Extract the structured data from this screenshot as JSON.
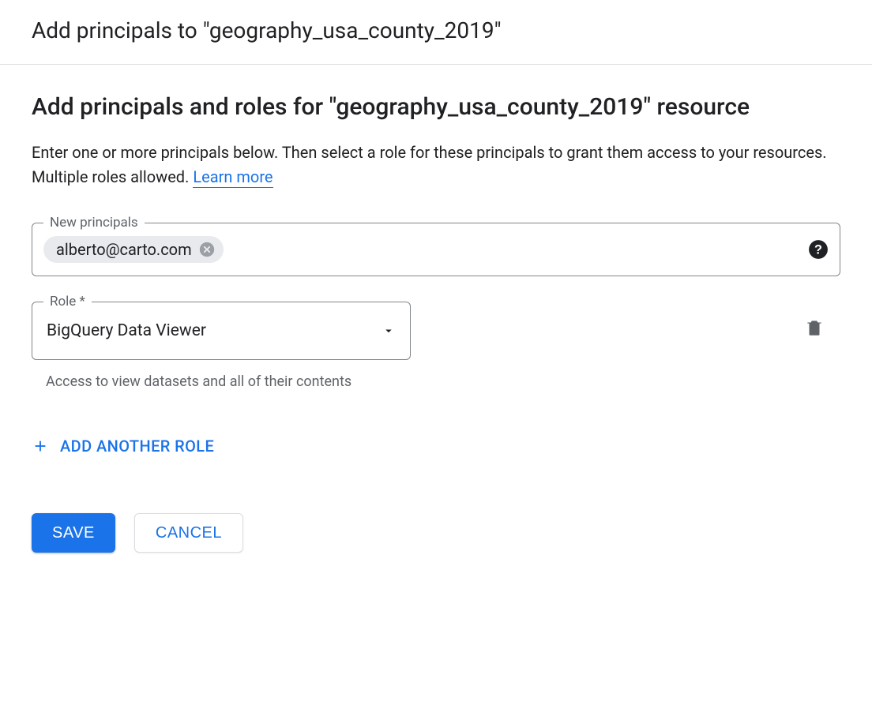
{
  "header": {
    "title": "Add principals to \"geography_usa_county_2019\""
  },
  "section": {
    "title": "Add principals and roles for \"geography_usa_county_2019\" resource",
    "description_prefix": "Enter one or more principals below. Then select a role for these principals to grant them access to your resources. Multiple roles allowed. ",
    "learn_more_label": "Learn more"
  },
  "principals": {
    "label": "New principals",
    "chips": [
      "alberto@carto.com"
    ]
  },
  "role": {
    "label": "Role *",
    "selected": "BigQuery Data Viewer",
    "helper": "Access to view datasets and all of their contents"
  },
  "add_another_role_label": "ADD ANOTHER ROLE",
  "buttons": {
    "save": "SAVE",
    "cancel": "CANCEL"
  }
}
